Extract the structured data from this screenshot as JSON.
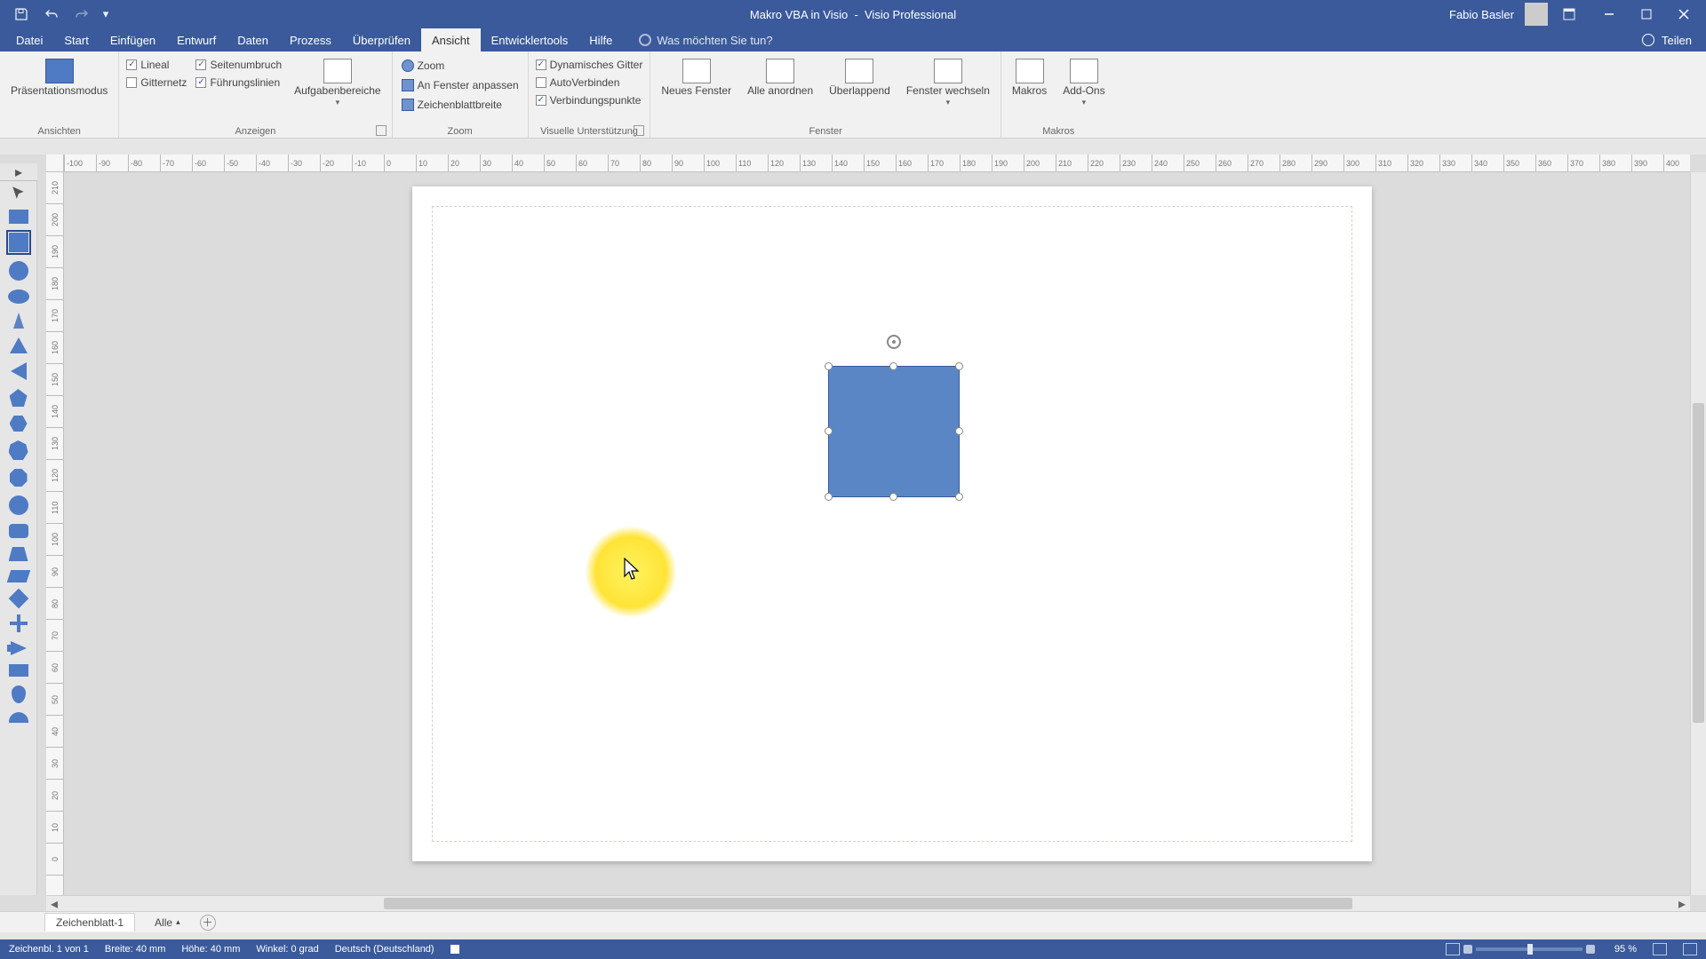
{
  "title": {
    "document": "Makro VBA in Visio",
    "app": "Visio Professional"
  },
  "user": {
    "name": "Fabio Basler"
  },
  "share": "Teilen",
  "tell_me": "Was möchten Sie tun?",
  "tabs": [
    "Datei",
    "Start",
    "Einfügen",
    "Entwurf",
    "Daten",
    "Prozess",
    "Überprüfen",
    "Ansicht",
    "Entwicklertools",
    "Hilfe"
  ],
  "active_tab_index": 7,
  "ribbon": {
    "ansichten": {
      "label": "Ansichten",
      "presentation": "Präsentationsmodus"
    },
    "anzeigen": {
      "label": "Anzeigen",
      "lineal": "Lineal",
      "seitenumbruch": "Seitenumbruch",
      "gitternetz": "Gitternetz",
      "fuehrungslinien": "Führungslinien",
      "aufgabenbereiche": "Aufgabenbereiche",
      "checks": {
        "lineal": true,
        "seitenumbruch": true,
        "gitternetz": false,
        "fuehrungslinien": true
      }
    },
    "zoom": {
      "label": "Zoom",
      "zoom": "Zoom",
      "anfenster": "An Fenster anpassen",
      "zeichenblatt": "Zeichenblattbreite"
    },
    "visuell": {
      "label": "Visuelle Unterstützung",
      "dyn_gitter": "Dynamisches Gitter",
      "autoverbinden": "AutoVerbinden",
      "verbindungspunkte": "Verbindungspunkte",
      "checks": {
        "dyn": true,
        "auto": false,
        "verb": true
      }
    },
    "fenster": {
      "label": "Fenster",
      "neues": "Neues Fenster",
      "alle": "Alle anordnen",
      "ueberlappend": "Überlappend",
      "wechseln": "Fenster wechseln"
    },
    "makros": {
      "label": "Makros",
      "makros": "Makros",
      "addons": "Add-Ons"
    }
  },
  "ruler": {
    "h": [
      "-100",
      "-90",
      "-80",
      "-70",
      "-60",
      "-50",
      "-40",
      "-30",
      "-20",
      "-10",
      "0",
      "10",
      "20",
      "30",
      "40",
      "50",
      "60",
      "70",
      "80",
      "90",
      "100",
      "110",
      "120",
      "130",
      "140",
      "150",
      "160",
      "170",
      "180",
      "190",
      "200",
      "210",
      "220",
      "230",
      "240",
      "250",
      "260",
      "270",
      "280",
      "290",
      "300",
      "310",
      "320",
      "330",
      "340",
      "350",
      "360",
      "370",
      "380",
      "390",
      "400"
    ],
    "v": [
      "210",
      "200",
      "190",
      "180",
      "170",
      "160",
      "150",
      "140",
      "130",
      "120",
      "110",
      "100",
      "90",
      "80",
      "70",
      "60",
      "50",
      "40",
      "30",
      "20",
      "10",
      "0"
    ],
    "corner": "🔻"
  },
  "sheet": {
    "name": "Zeichenblatt-1",
    "selector": "Alle"
  },
  "status": {
    "page_of": "Zeichenbl. 1 von 1",
    "width": "Breite: 40 mm",
    "height": "Höhe: 40 mm",
    "angle": "Winkel: 0 grad",
    "lang": "Deutsch (Deutschland)",
    "zoom": "95 %"
  }
}
